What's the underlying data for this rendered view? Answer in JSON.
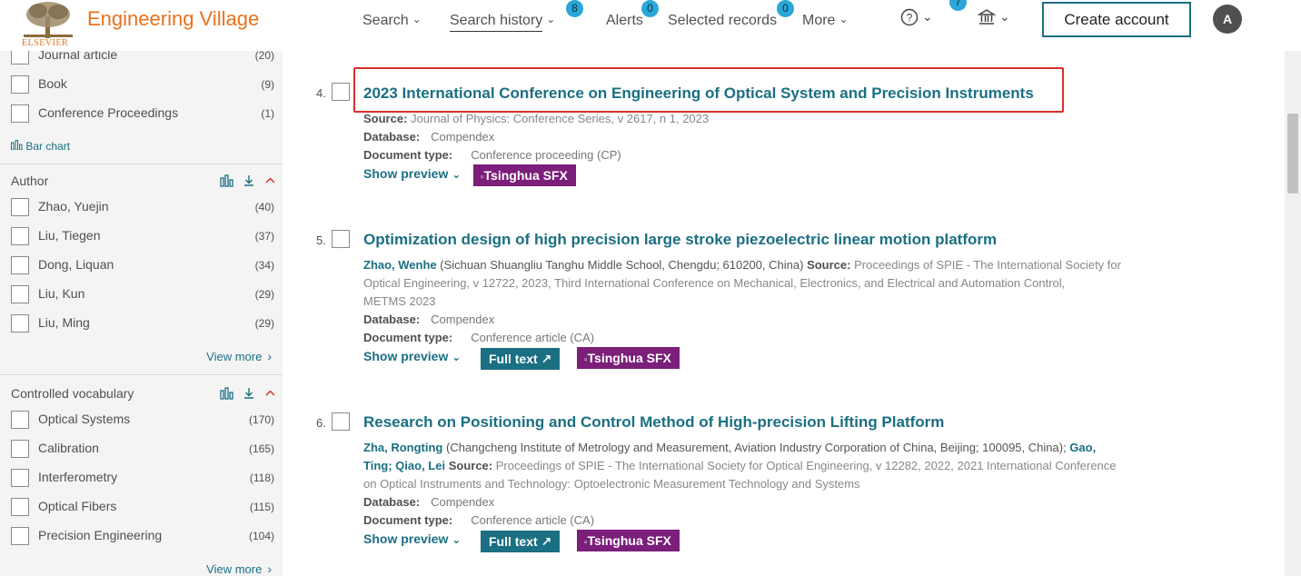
{
  "header": {
    "brand": "Engineering Village",
    "publisher": "ELSEVIER",
    "nav": {
      "search": "Search",
      "search_history": "Search history",
      "search_history_badge": "8",
      "alerts": "Alerts",
      "alerts_badge": "0",
      "selected_records": "Selected records",
      "selected_records_badge": "0",
      "more": "More",
      "help_badge": "7"
    },
    "create_account": "Create account",
    "avatar_initial": "A"
  },
  "sidebar": {
    "doc_types": [
      {
        "label": "Journal article",
        "count": "(20)"
      },
      {
        "label": "Book",
        "count": "(9)"
      },
      {
        "label": "Conference Proceedings",
        "count": "(1)"
      }
    ],
    "bar_chart_label": "Bar chart",
    "author": {
      "title": "Author",
      "items": [
        {
          "label": "Zhao, Yuejin",
          "count": "(40)"
        },
        {
          "label": "Liu, Tiegen",
          "count": "(37)"
        },
        {
          "label": "Dong, Liquan",
          "count": "(34)"
        },
        {
          "label": "Liu, Kun",
          "count": "(29)"
        },
        {
          "label": "Liu, Ming",
          "count": "(29)"
        }
      ],
      "view_more": "View more"
    },
    "controlled_vocabulary": {
      "title": "Controlled vocabulary",
      "items": [
        {
          "label": "Optical Systems",
          "count": "(170)"
        },
        {
          "label": "Calibration",
          "count": "(165)"
        },
        {
          "label": "Interferometry",
          "count": "(118)"
        },
        {
          "label": "Optical Fibers",
          "count": "(115)"
        },
        {
          "label": "Precision Engineering",
          "count": "(104)"
        }
      ],
      "view_more": "View more"
    }
  },
  "results": [
    {
      "num": "4.",
      "title": "2023 International Conference on Engineering of Optical System and Precision Instruments",
      "source_label": "Source:",
      "source": "Journal of Physics: Conference Series, v 2617, n 1, 2023",
      "database_label": "Database:",
      "database": "Compendex",
      "doctype_label": "Document type:",
      "doctype": "Conference proceeding (CP)",
      "preview": "Show preview",
      "sfx": "Tsinghua SFX"
    },
    {
      "num": "5.",
      "title": "Optimization design of high precision large stroke piezoelectric linear motion platform",
      "author": "Zhao, Wenhe",
      "affiliation": "(Sichuan Shuangliu Tanghu Middle School, Chengdu; 610200, China)",
      "source_label": "Source:",
      "source_l1": "Proceedings of SPIE - The International Society for",
      "source_l2": "Optical Engineering, v 12722, 2023, Third International Conference on Mechanical, Electronics, and Electrical and Automation Control,",
      "source_l3": "METMS 2023",
      "database_label": "Database:",
      "database": "Compendex",
      "doctype_label": "Document type:",
      "doctype": "Conference article (CA)",
      "preview": "Show preview",
      "fulltext": "Full text",
      "sfx": "Tsinghua SFX"
    },
    {
      "num": "6.",
      "title": "Research on Positioning and Control Method of High-precision Lifting Platform",
      "author": "Zha, Rongting",
      "affiliation": "(Changcheng Institute of Metrology and Measurement, Aviation Industry Corporation of China, Beijing; 100095, China);",
      "author2_a": "Gao,",
      "author2_b": "Ting",
      "author3": "Qiao, Lei",
      "source_label": "Source:",
      "source_l1": "Proceedings of SPIE - The International Society for Optical Engineering, v 12282, 2022, 2021 International Conference",
      "source_l2": "on Optical Instruments and Technology: Optoelectronic Measurement Technology and Systems",
      "database_label": "Database:",
      "database": "Compendex",
      "doctype_label": "Document type:",
      "doctype": "Conference article (CA)",
      "preview": "Show preview",
      "fulltext": "Full text",
      "sfx": "Tsinghua SFX"
    }
  ],
  "colors": {
    "brand": "#e9711c",
    "link": "#1b6f83",
    "sfx": "#7b1f7a",
    "highlight": "#d9302b",
    "badge": "#2aa7d8"
  }
}
